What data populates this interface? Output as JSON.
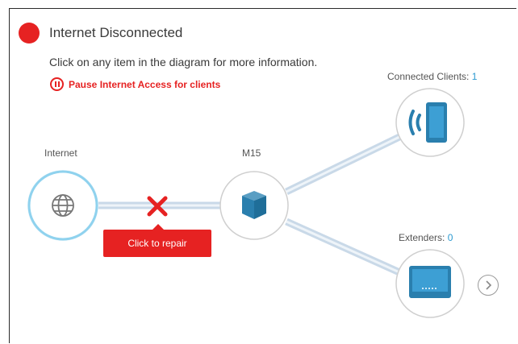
{
  "status": {
    "title": "Internet Disconnected",
    "indicator_color": "#e62222"
  },
  "hint": "Click on any item in the diagram for more information.",
  "pause": {
    "label": "Pause Internet Access for clients",
    "icon": "pause-circle-icon"
  },
  "nodes": {
    "internet": {
      "label": "Internet",
      "icon": "globe-icon"
    },
    "router": {
      "label": "M15",
      "icon": "router-icon"
    },
    "clients": {
      "label": "Connected Clients: ",
      "count": "1",
      "icon": "wifi-device-icon"
    },
    "extenders": {
      "label": "Extenders: ",
      "count": "0",
      "icon": "extender-icon"
    }
  },
  "repair": {
    "label": "Click to repair",
    "icon": "x-mark-icon"
  },
  "colors": {
    "accent_red": "#e62222",
    "link_blue": "#2c9ad1",
    "device_teal": "#2a7fae",
    "line_blue": "#c5d6e6"
  },
  "next_icon": "chevron-right-icon"
}
